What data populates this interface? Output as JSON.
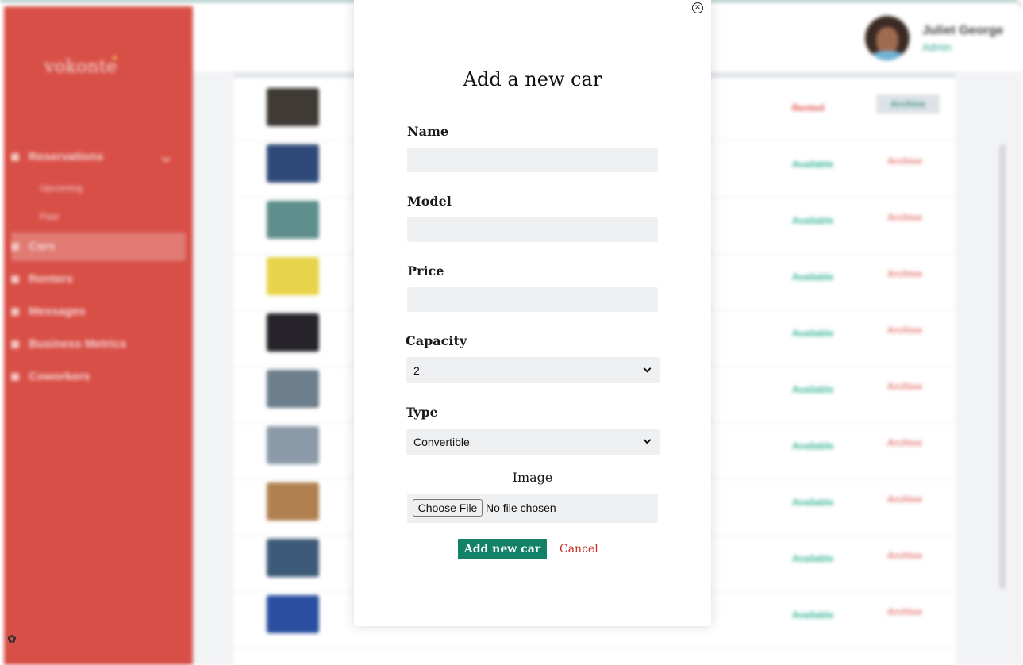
{
  "app": {
    "brand": "vokonte",
    "user": {
      "name": "Juliet George",
      "role": "Admin"
    },
    "sidebar": {
      "items": [
        {
          "label": "Reservations",
          "icon": "home-icon",
          "expanded": true
        },
        {
          "label": "Cars",
          "icon": "car-icon",
          "active": true
        },
        {
          "label": "Renters",
          "icon": "users-icon"
        },
        {
          "label": "Messages",
          "icon": "message-icon"
        },
        {
          "label": "Business Metrics",
          "icon": "chart-icon"
        },
        {
          "label": "Coworkers",
          "icon": "team-icon"
        }
      ],
      "subitems": [
        "Upcoming",
        "Past"
      ]
    },
    "rows": [
      {
        "status": "Rented",
        "status_color": "#e05b53",
        "action": "Archive",
        "boxed": true
      },
      {
        "status": "Available",
        "status_color": "#39b497",
        "action": "Archive"
      },
      {
        "status": "Available",
        "status_color": "#39b497",
        "action": "Archive"
      },
      {
        "status": "Available",
        "status_color": "#39b497",
        "action": "Archive"
      },
      {
        "status": "Available",
        "status_color": "#39b497",
        "action": "Archive"
      },
      {
        "status": "Available",
        "status_color": "#39b497",
        "action": "Archive"
      },
      {
        "status": "Available",
        "status_color": "#39b497",
        "action": "Archive"
      },
      {
        "status": "Available",
        "status_color": "#39b497",
        "action": "Archive"
      },
      {
        "status": "Available",
        "status_color": "#39b497",
        "action": "Archive"
      },
      {
        "status": "Available",
        "status_color": "#39b497",
        "action": "Archive"
      }
    ]
  },
  "modal": {
    "close_icon": "close-circle-icon",
    "title": "Add a new car",
    "fields": {
      "name_label": "Name",
      "name_value": "",
      "model_label": "Model",
      "model_value": "",
      "price_label": "Price",
      "price_value": "",
      "capacity_label": "Capacity",
      "capacity_value": "2",
      "type_label": "Type",
      "type_value": "Convertible",
      "image_label": "Image",
      "file_button": "Choose File",
      "file_status": "No file chosen"
    },
    "submit_label": "Add new car",
    "cancel_label": "Cancel",
    "colors": {
      "primary": "#138068",
      "danger": "#c62a22",
      "sidebar": "#d84f47"
    }
  }
}
